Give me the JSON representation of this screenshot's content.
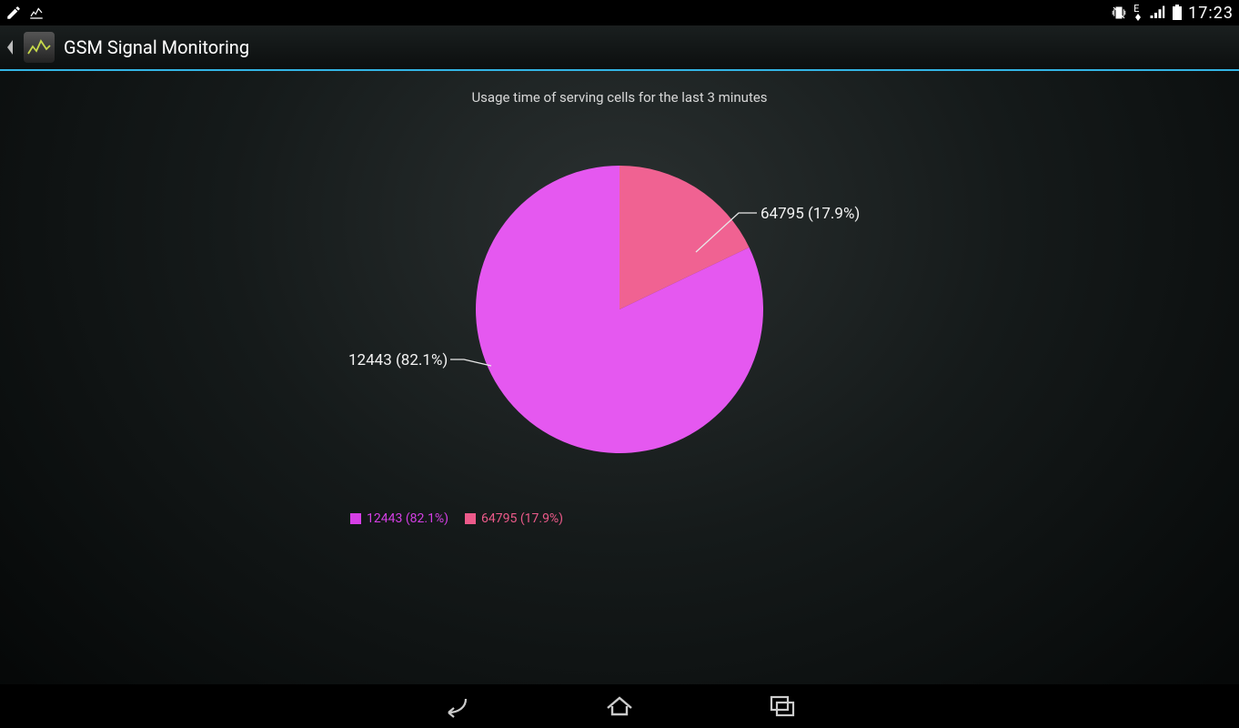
{
  "status": {
    "clock": "17:23",
    "network_type": "E"
  },
  "action_bar": {
    "title": "GSM Signal Monitoring"
  },
  "chart": {
    "title": "Usage time of serving cells for the last 3 minutes",
    "label_a": "12443 (82.1%)",
    "label_b": "64795 (17.9%)"
  },
  "legend": {
    "a": "12443 (82.1%)",
    "b": "64795 (17.9%)"
  },
  "colors": {
    "slice_a": "#e558f0",
    "slice_b": "#f06292",
    "legend_a": "#d63fe6",
    "legend_b": "#ec5a8a",
    "accent": "#33b5e5"
  },
  "chart_data": {
    "type": "pie",
    "title": "Usage time of serving cells for the last 3 minutes",
    "series": [
      {
        "name": "12443",
        "value": 82.1,
        "label": "12443 (82.1%)",
        "color": "#e558f0"
      },
      {
        "name": "64795",
        "value": 17.9,
        "label": "64795 (17.9%)",
        "color": "#f06292"
      }
    ],
    "legend_position": "bottom"
  }
}
